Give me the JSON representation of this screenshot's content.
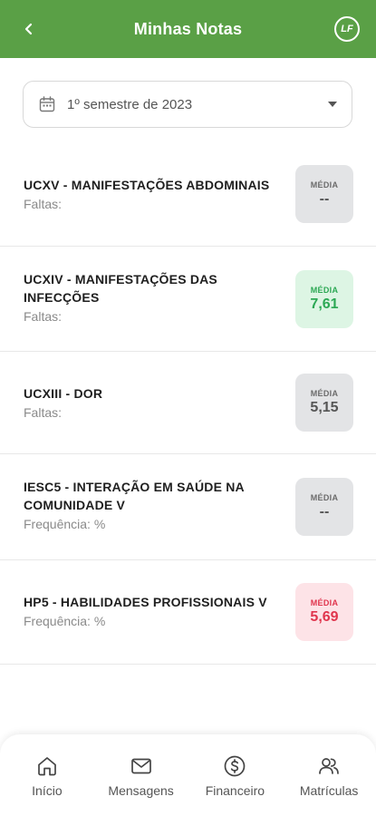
{
  "header": {
    "title": "Minhas Notas",
    "logo_text": "LF"
  },
  "filter": {
    "semester": "1º semestre de 2023"
  },
  "subjects": [
    {
      "name": "UCXV - MANIFESTAÇÕES ABDOMINAIS",
      "sub": "Faltas:",
      "media_label": "MÉDIA",
      "media": "--",
      "status": "neutral"
    },
    {
      "name": "UCXIV - MANIFESTAÇÕES DAS INFECÇÕES",
      "sub": "Faltas:",
      "media_label": "MÉDIA",
      "media": "7,61",
      "status": "good"
    },
    {
      "name": "UCXIII - DOR",
      "sub": "Faltas:",
      "media_label": "MÉDIA",
      "media": "5,15",
      "status": "neutral"
    },
    {
      "name": "IESC5 - INTERAÇÃO EM SAÚDE NA COMUNIDADE V",
      "sub": "Frequência: %",
      "media_label": "MÉDIA",
      "media": "--",
      "status": "neutral"
    },
    {
      "name": "HP5 - HABILIDADES PROFISSIONAIS V",
      "sub": "Frequência: %",
      "media_label": "MÉDIA",
      "media": "5,69",
      "status": "bad"
    }
  ],
  "tabs": [
    {
      "label": "Início",
      "icon": "home-icon"
    },
    {
      "label": "Mensagens",
      "icon": "envelope-icon"
    },
    {
      "label": "Financeiro",
      "icon": "dollar-icon"
    },
    {
      "label": "Matrículas",
      "icon": "users-icon"
    }
  ],
  "colors": {
    "header": "#5aa046",
    "good": "#2ca854",
    "bad": "#e0354d"
  }
}
